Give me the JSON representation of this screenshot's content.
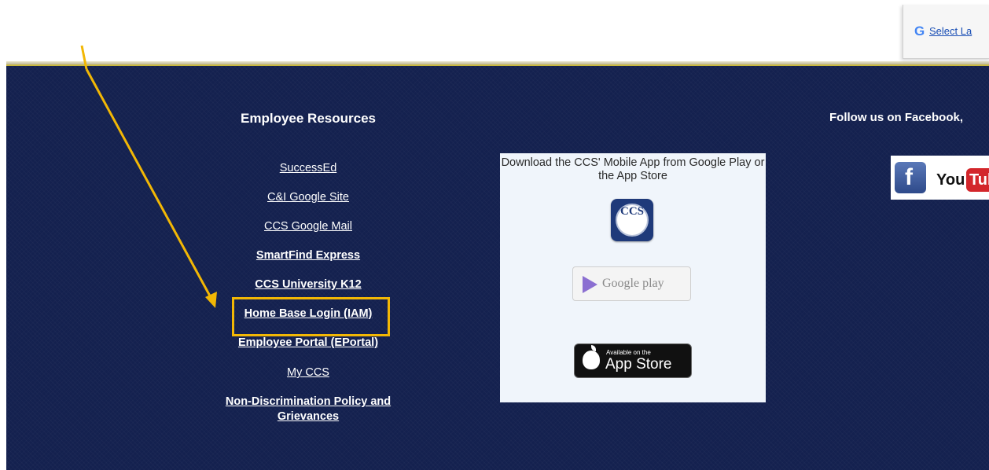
{
  "translate": {
    "icon": "G",
    "link_label": "Select La"
  },
  "employee_resources": {
    "heading": "Employee Resources",
    "links": [
      {
        "label": "SuccessEd",
        "bold": false
      },
      {
        "label": "C&I Google Site",
        "bold": false
      },
      {
        "label": "CCS Google Mail",
        "bold": false
      },
      {
        "label": "SmartFind Express",
        "bold": true
      },
      {
        "label": "CCS University K12",
        "bold": true
      },
      {
        "label": "Home Base Login (IAM)",
        "bold": true
      },
      {
        "label": "Employee Portal (EPortal)",
        "bold": true
      },
      {
        "label": "My CCS",
        "bold": false
      },
      {
        "label": "Non-Discrimination Policy and Grievances",
        "bold": true
      }
    ]
  },
  "app_box": {
    "text": "Download the CCS' Mobile App from Google Play or the App Store",
    "logo_text": "CCS",
    "google_play_label": "Google play",
    "app_store_small": "Available on the",
    "app_store_label": "App Store"
  },
  "social": {
    "heading": "Follow us on Facebook,",
    "facebook_glyph": "f",
    "youtube_you": "You",
    "youtube_tube": "Tub"
  },
  "colors": {
    "footer_background": "#14214f",
    "annotation": "#f2b705",
    "link": "#ffffff"
  }
}
